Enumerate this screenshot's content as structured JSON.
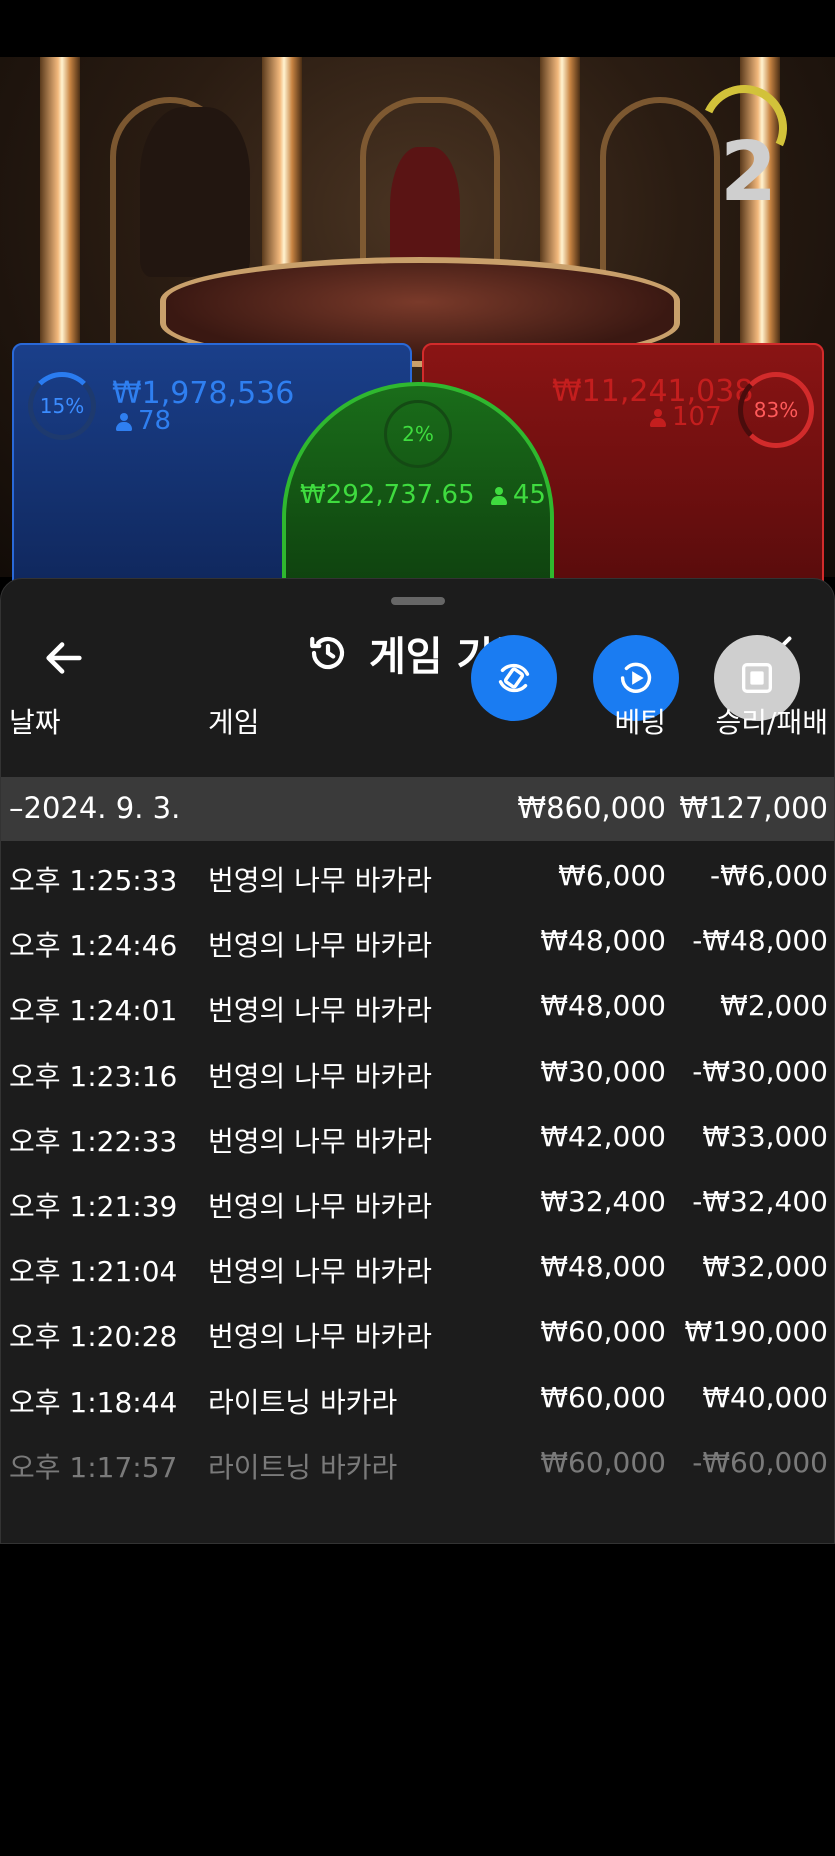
{
  "scene": {
    "round_number": "2",
    "bets": {
      "player": {
        "percent": "15%",
        "amount": "₩1,978,536",
        "players": "78",
        "color": "#2a7cf0"
      },
      "tie": {
        "percent": "2%",
        "amount": "₩292,737.65",
        "players": "45",
        "color": "#2fb82f"
      },
      "banker": {
        "percent": "83%",
        "amount": "₩11,241,038",
        "players": "107",
        "color": "#d22b2b"
      }
    }
  },
  "history": {
    "title": "게임 기록",
    "columns": {
      "date": "날짜",
      "game": "게임",
      "bet": "베팅",
      "result": "승리/패배"
    },
    "summary": {
      "date": "–2024. 9. 3.",
      "bet": "₩860,000",
      "result": "₩127,000"
    },
    "rows": [
      {
        "time": "오후 1:25:33",
        "game": "번영의 나무 바카라",
        "bet": "₩6,000",
        "result": "-₩6,000"
      },
      {
        "time": "오후 1:24:46",
        "game": "번영의 나무 바카라",
        "bet": "₩48,000",
        "result": "-₩48,000"
      },
      {
        "time": "오후 1:24:01",
        "game": "번영의 나무 바카라",
        "bet": "₩48,000",
        "result": "₩2,000"
      },
      {
        "time": "오후 1:23:16",
        "game": "번영의 나무 바카라",
        "bet": "₩30,000",
        "result": "-₩30,000"
      },
      {
        "time": "오후 1:22:33",
        "game": "번영의 나무 바카라",
        "bet": "₩42,000",
        "result": "₩33,000"
      },
      {
        "time": "오후 1:21:39",
        "game": "번영의 나무 바카라",
        "bet": "₩32,400",
        "result": "-₩32,400"
      },
      {
        "time": "오후 1:21:04",
        "game": "번영의 나무 바카라",
        "bet": "₩48,000",
        "result": "₩32,000"
      },
      {
        "time": "오후 1:20:28",
        "game": "번영의 나무 바카라",
        "bet": "₩60,000",
        "result": "₩190,000"
      },
      {
        "time": "오후 1:18:44",
        "game": "라이트닝 바카라",
        "bet": "₩60,000",
        "result": "₩40,000"
      },
      {
        "time": "오후 1:17:57",
        "game": "라이트닝 바카라",
        "bet": "₩60,000",
        "result": "-₩60,000"
      }
    ]
  },
  "icons": {
    "back": "arrow-left-icon",
    "history": "history-clock-icon",
    "close": "close-icon",
    "fab_rotate": "rotate-icon",
    "fab_play": "replay-play-icon",
    "fab_stop": "stop-icon"
  },
  "colors": {
    "fab_blue": "#1a7cf2",
    "sheet_bg": "#1c1c1c",
    "summary_bg": "#3a3a3a"
  }
}
